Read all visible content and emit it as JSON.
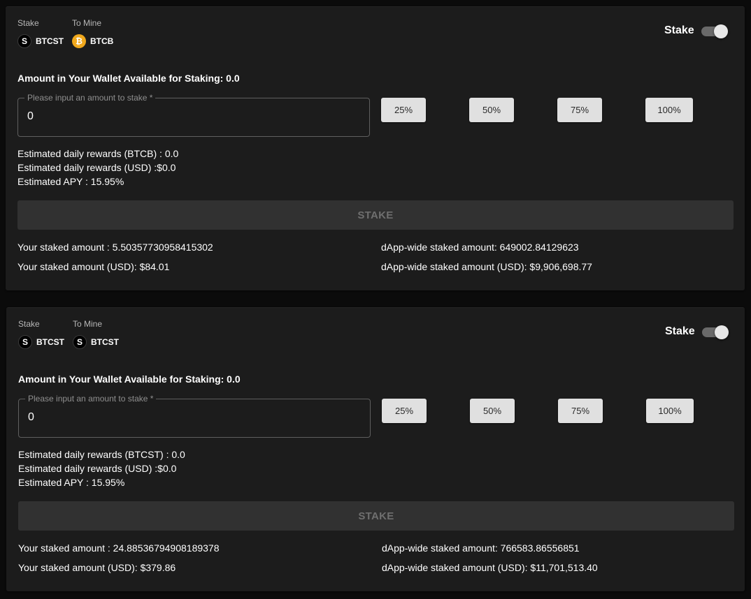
{
  "pools": [
    {
      "stake_label": "Stake",
      "mine_label": "To Mine",
      "stake_token": "BTCST",
      "mine_token": "BTCB",
      "stake_token_icon": "btcst-icon",
      "mine_token_icon": "btcb-icon",
      "toggle_label": "Stake",
      "toggle_on": true,
      "available": "Amount in Your Wallet Available for Staking: 0.0",
      "input_placeholder": "Please input an amount to stake *",
      "input_value": "0",
      "percent_buttons": [
        "25%",
        "50%",
        "75%",
        "100%"
      ],
      "est_daily_token": "Estimated daily rewards (BTCB) : 0.0",
      "est_daily_usd": "Estimated daily rewards (USD) :$0.0",
      "est_apy": "Estimated APY : 15.95%",
      "stake_button": "STAKE",
      "your_staked": "Your staked amount : 5.50357730958415302",
      "your_staked_usd": "Your staked amount (USD): $84.01",
      "dapp_staked": "dApp-wide staked amount: 649002.84129623",
      "dapp_staked_usd": "dApp-wide staked amount (USD): $9,906,698.77"
    },
    {
      "stake_label": "Stake",
      "mine_label": "To Mine",
      "stake_token": "BTCST",
      "mine_token": "BTCST",
      "stake_token_icon": "btcst-icon",
      "mine_token_icon": "btcst-icon",
      "toggle_label": "Stake",
      "toggle_on": true,
      "available": "Amount in Your Wallet Available for Staking: 0.0",
      "input_placeholder": "Please input an amount to stake *",
      "input_value": "0",
      "percent_buttons": [
        "25%",
        "50%",
        "75%",
        "100%"
      ],
      "est_daily_token": "Estimated daily rewards (BTCST) : 0.0",
      "est_daily_usd": "Estimated daily rewards (USD) :$0.0",
      "est_apy": "Estimated APY : 15.95%",
      "stake_button": "STAKE",
      "your_staked": "Your staked amount : 24.88536794908189378",
      "your_staked_usd": "Your staked amount (USD): $379.86",
      "dapp_staked": "dApp-wide staked amount: 766583.86556851",
      "dapp_staked_usd": "dApp-wide staked amount (USD): $11,701,513.40"
    }
  ],
  "colors": {
    "page_bg": "#0b0b0b",
    "card_bg": "#1c1c1c",
    "btcb_icon": "#f0a81c",
    "percent_button_bg": "#e0e0e0",
    "stake_button_bg": "#313131"
  }
}
